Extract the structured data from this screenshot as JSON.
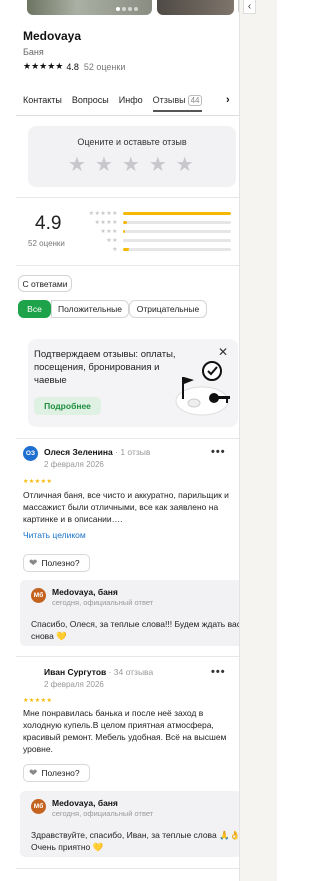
{
  "place": {
    "title": "Medovaya",
    "category": "Баня",
    "rating": "4.8",
    "rating_count": "52 оценки",
    "rating_stars": "★★★★★"
  },
  "tabs": [
    {
      "label": "Контакты"
    },
    {
      "label": "Вопросы"
    },
    {
      "label": "Инфо"
    },
    {
      "label": "Отзывы",
      "badge": "44",
      "active": true
    }
  ],
  "tabs_more_icon": "chevron-right-icon",
  "rate_prompt": {
    "label": "Оцените и оставьте отзыв",
    "stars": "★★★★★"
  },
  "summary": {
    "score": "4.9",
    "count": "52 оценки",
    "distribution": [
      {
        "stars": "★★★★★",
        "fraction": 1.0
      },
      {
        "stars": "★★★★",
        "fraction": 0.04
      },
      {
        "stars": "★★★",
        "fraction": 0.02
      },
      {
        "stars": "★★",
        "fraction": 0.0
      },
      {
        "stars": "★",
        "fraction": 0.06
      }
    ]
  },
  "filters": {
    "with_answers": "С ответами",
    "all": "Все",
    "positive": "Положительные",
    "negative": "Отрицательные"
  },
  "promo": {
    "text": "Подтверждаем отзывы: оплаты, посещения, бронирования и чаевые",
    "button": "Подробнее",
    "close_icon": "close-icon"
  },
  "reviews": [
    {
      "avatar": "ОЗ",
      "avatar_color": "#1f6fd0",
      "author": "Олеся Зеленина",
      "meta": "· 1 отзыв",
      "date": "2 февраля 2026",
      "stars": "★★★★★",
      "text": "Отличная баня, все чисто и аккуратно, парильщик и массажист были отличными, все как заявлено на картинке и в описании….",
      "read_more": "Читать целиком",
      "helpful": "Полезно?",
      "reply": {
        "avatar": "Мб",
        "author": "Medovaya, баня",
        "meta": "сегодня, официальный ответ",
        "text": "Спасибо, Олеся, за теплые слова!!! Будем ждать вас снова 💛"
      }
    },
    {
      "avatar": "",
      "author": "Иван Сургутов",
      "meta": "· 34 отзыва",
      "date": "2 февраля 2026",
      "stars": "★★★★★",
      "text": "Мне понравилась банька и после неё заход в холодную купель.В целом приятная атмосфера, красивый ремонт. Мебель удобная. Всё на высшем уровне.",
      "helpful": "Полезно?",
      "reply": {
        "avatar": "Мб",
        "author": "Medovaya, баня",
        "meta": "сегодня, официальный ответ",
        "text": "Здравствуйте, спасибо, Иван, за теплые слова 🙏👌 Очень приятно 💛"
      }
    }
  ],
  "colors": {
    "accent_green": "#1ea34a",
    "star_yellow": "#f5b800",
    "link_blue": "#1a73c8",
    "business_avatar": "#c4631f"
  }
}
